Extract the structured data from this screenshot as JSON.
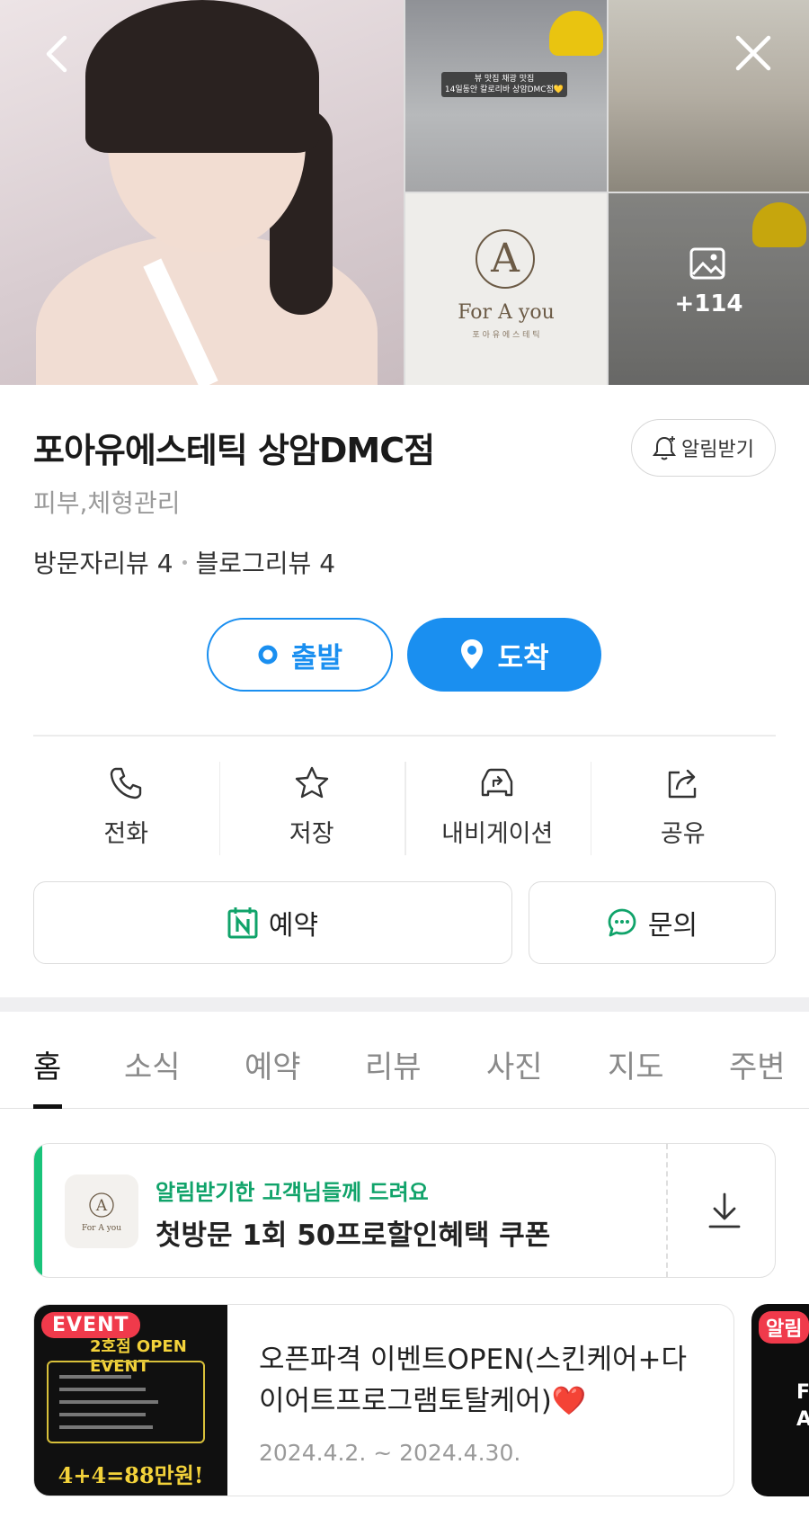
{
  "gallery": {
    "photo_sign_text": "뷰 맛집 채광 맛집\n14일동안 칼로리바 상암DMC점💛",
    "logo_text": "For A you",
    "logo_sub": "포 아 유 에 스 테 틱",
    "more_count": "+114"
  },
  "place": {
    "title": "포아유에스테틱 상암DMC점",
    "notify_label": "알림받기",
    "category": "피부,체형관리",
    "visitor_review": "방문자리뷰 4",
    "blog_review": "블로그리뷰 4"
  },
  "route": {
    "depart_label": "출발",
    "arrive_label": "도착"
  },
  "actions": [
    {
      "label": "전화",
      "icon": "phone-icon"
    },
    {
      "label": "저장",
      "icon": "star-icon"
    },
    {
      "label": "내비게이션",
      "icon": "car-navigation-icon"
    },
    {
      "label": "공유",
      "icon": "share-icon"
    }
  ],
  "buttons": {
    "reserve_label": "예약",
    "inquire_label": "문의"
  },
  "tabs": [
    {
      "label": "홈",
      "active": true
    },
    {
      "label": "소식",
      "active": false
    },
    {
      "label": "예약",
      "active": false
    },
    {
      "label": "리뷰",
      "active": false
    },
    {
      "label": "사진",
      "active": false
    },
    {
      "label": "지도",
      "active": false
    },
    {
      "label": "주변",
      "active": false
    }
  ],
  "coupon": {
    "subtitle": "알림받기한 고객님들께 드려요",
    "title": "첫방문 1회 50프로할인혜택 쿠폰",
    "logo_text": "For A you"
  },
  "events": [
    {
      "badge": "EVENT",
      "image_header": "2호점 OPEN EVENT",
      "image_price": "4+4=88만원!",
      "title": "오픈파격 이벤트OPEN(스킨케어+다이어트프로그램토탈케어)",
      "emoji": "❤️",
      "date": "2024.4.2. ~ 2024.4.30."
    },
    {
      "badge": "알림",
      "image_text": "F\nA"
    }
  ],
  "colors": {
    "primary_blue": "#1a8ff0",
    "naver_green": "#10a36a",
    "event_red": "#f03a4b"
  }
}
